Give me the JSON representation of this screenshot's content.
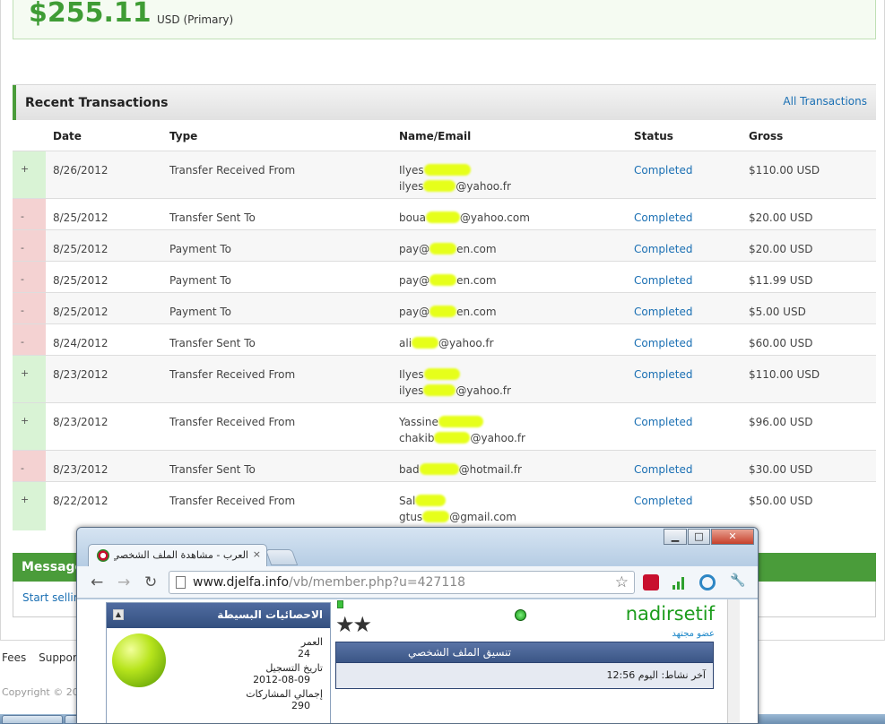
{
  "balance": {
    "amount": "$255.11",
    "currency": "USD (Primary)"
  },
  "transactions": {
    "title": "Recent Transactions",
    "all_link": "All Transactions",
    "columns": {
      "date": "Date",
      "type": "Type",
      "name": "Name/Email",
      "status": "Status",
      "gross": "Gross"
    },
    "rows": [
      {
        "sign": "+",
        "date": "8/26/2012",
        "type": "Transfer Received From",
        "name1": "Ilyes",
        "name2a": "ilyes",
        "name2b": "@yahoo.fr",
        "status": "Completed",
        "gross": "$110.00 USD"
      },
      {
        "sign": "-",
        "date": "8/25/2012",
        "type": "Transfer Sent To",
        "name1a": "boua",
        "name1b": "@yahoo.com",
        "status": "Completed",
        "gross": "$20.00 USD"
      },
      {
        "sign": "-",
        "date": "8/25/2012",
        "type": "Payment To",
        "name1a": "pay@",
        "name1b": "en.com",
        "status": "Completed",
        "gross": "$20.00 USD"
      },
      {
        "sign": "-",
        "date": "8/25/2012",
        "type": "Payment To",
        "name1a": "pay@",
        "name1b": "en.com",
        "status": "Completed",
        "gross": "$11.99 USD"
      },
      {
        "sign": "-",
        "date": "8/25/2012",
        "type": "Payment To",
        "name1a": "pay@",
        "name1b": "en.com",
        "status": "Completed",
        "gross": "$5.00 USD"
      },
      {
        "sign": "-",
        "date": "8/24/2012",
        "type": "Transfer Sent To",
        "name1a": "ali",
        "name1b": "@yahoo.fr",
        "status": "Completed",
        "gross": "$60.00 USD"
      },
      {
        "sign": "+",
        "date": "8/23/2012",
        "type": "Transfer Received From",
        "name1": "Ilyes",
        "name2a": "ilyes",
        "name2b": "@yahoo.fr",
        "status": "Completed",
        "gross": "$110.00 USD"
      },
      {
        "sign": "+",
        "date": "8/23/2012",
        "type": "Transfer Received From",
        "name1": "Yassine",
        "name2a": "chakib",
        "name2b": "@yahoo.fr",
        "status": "Completed",
        "gross": "$96.00 USD"
      },
      {
        "sign": "-",
        "date": "8/23/2012",
        "type": "Transfer Sent To",
        "name1a": "bad",
        "name1b": "@hotmail.fr",
        "status": "Completed",
        "gross": "$30.00 USD"
      },
      {
        "sign": "+",
        "date": "8/22/2012",
        "type": "Transfer Received From",
        "name1": "Sal",
        "name2a": "gtus",
        "name2b": "@gmail.com",
        "status": "Completed",
        "gross": "$50.00 USD"
      }
    ]
  },
  "message": {
    "title": "Message",
    "link": "Start sellin"
  },
  "footer": {
    "links": [
      "Fees",
      "Support"
    ],
    "copyright": "Copyright © 20"
  },
  "chrome": {
    "tab_title": "العرب - مشاهدة الملف الشخصي",
    "tab_close": "×",
    "url_host": "www.djelfa.info",
    "url_path": "/vb/member.php?u=427118",
    "win_min": "▁",
    "win_max": "□",
    "win_close": "✕",
    "back": "←",
    "forward": "→",
    "reload": "↻",
    "star": "☆",
    "wrench": "🔧",
    "colors": {
      "accent_green": "#3f9c35",
      "link_blue": "#1a6fb3"
    }
  },
  "profile": {
    "stats_title": "الاحصائيات البسيطة",
    "collapse": "▲",
    "age_label": "العمر",
    "age_value": "24",
    "reg_label": "تاريخ التسجيل",
    "reg_value": "2012-08-09",
    "posts_label": "إجمالي المشاركات",
    "posts_value": "290",
    "username": "nadirsetif",
    "rank": "عضو مجتهد",
    "stars": "★★",
    "profile_tab": "تنسيق الملف الشخصي",
    "last_active": "آخر نشاط: اليوم 12:56"
  }
}
